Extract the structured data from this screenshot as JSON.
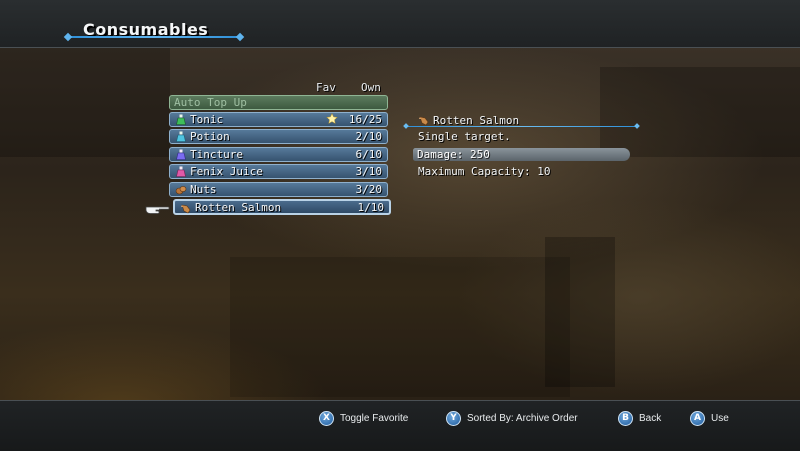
{
  "screen": {
    "title": "Consumables"
  },
  "list": {
    "headers": {
      "fav": "Fav",
      "own": "Own"
    },
    "auto_top_up": "Auto Top Up",
    "items": [
      {
        "name": "Tonic",
        "own": "16/25",
        "favorite": true,
        "icon": "tonic-flask-icon",
        "icon_color": "#3fbf5a"
      },
      {
        "name": "Potion",
        "own": "2/10",
        "favorite": false,
        "icon": "potion-flask-icon",
        "icon_color": "#4fc3e0"
      },
      {
        "name": "Tincture",
        "own": "6/10",
        "favorite": false,
        "icon": "tincture-flask-icon",
        "icon_color": "#7a6cf0"
      },
      {
        "name": "Fenix Juice",
        "own": "3/10",
        "favorite": false,
        "icon": "fenix-juice-icon",
        "icon_color": "#e05aa8"
      },
      {
        "name": "Nuts",
        "own": "3/20",
        "favorite": false,
        "icon": "nuts-icon",
        "icon_color": "#b8743a"
      },
      {
        "name": "Rotten Salmon",
        "own": "1/10",
        "favorite": false,
        "icon": "rotten-salmon-icon",
        "icon_color": "#c98a4a",
        "selected": true
      }
    ]
  },
  "detail": {
    "name": "Rotten Salmon",
    "description": "Single target.",
    "damage": "Damage: 250",
    "capacity": "Maximum Capacity: 10"
  },
  "hints": [
    {
      "button": "X",
      "label": "Toggle Favorite",
      "color": "#3f7fd0"
    },
    {
      "button": "Y",
      "label": "Sorted By: Archive Order",
      "color": "#3f7fd0"
    },
    {
      "button": "B",
      "label": "Back",
      "color": "#3f7fd0"
    },
    {
      "button": "A",
      "label": "Use",
      "color": "#3f7fd0"
    }
  ]
}
